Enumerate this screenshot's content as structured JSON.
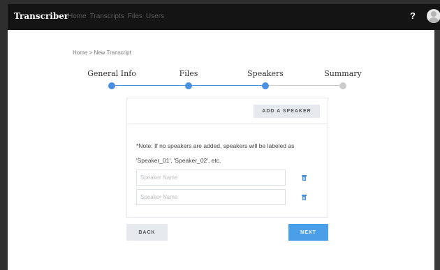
{
  "app": {
    "brand": "Transcriber"
  },
  "nav": {
    "items": [
      "Home",
      "Transcripts",
      "Files",
      "Users"
    ]
  },
  "header": {
    "help": "?"
  },
  "breadcrumb": "Home > New Transcript",
  "steps": {
    "items": [
      {
        "label": "General Info",
        "status": "complete"
      },
      {
        "label": "Files",
        "status": "complete"
      },
      {
        "label": "Speakers",
        "status": "current"
      },
      {
        "label": "Summary",
        "status": "upcoming"
      }
    ]
  },
  "speakers": {
    "add_label": "ADD A SPEAKER",
    "note": "*Note: If no speakers are added, speakers will be labeled as 'Speaker_01', 'Speaker_02', etc.",
    "inputs": [
      {
        "value": "",
        "placeholder": "Speaker Name"
      },
      {
        "value": "",
        "placeholder": "Speaker Name"
      }
    ]
  },
  "footer": {
    "back_label": "BACK",
    "next_label": "NEXT"
  },
  "colors": {
    "accent": "#4a9fe8",
    "step_complete": "#4a90e2",
    "step_upcoming": "#cccccc",
    "topbar": "#141414"
  }
}
